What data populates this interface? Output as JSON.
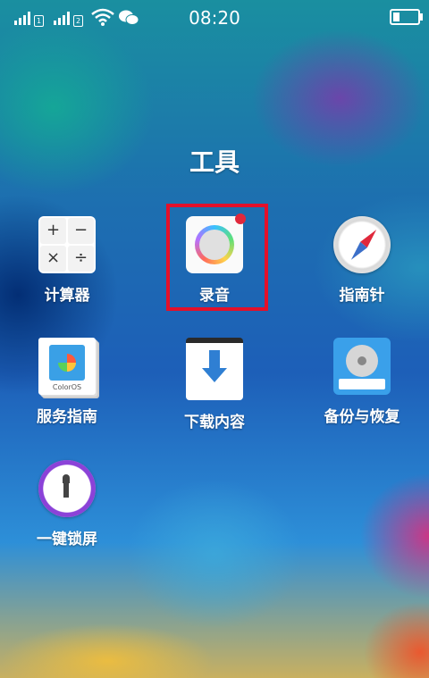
{
  "status_bar": {
    "sim1_label": "1",
    "sim2_label": "2",
    "time": "08:20",
    "icons": [
      "signal-icon",
      "signal-icon",
      "wifi-icon",
      "wechat-icon",
      "battery-icon"
    ],
    "battery_level": 0.25
  },
  "folder": {
    "title": "工具",
    "apps": [
      {
        "label": "计算器",
        "icon": "calculator-icon"
      },
      {
        "label": "录音",
        "icon": "recorder-icon",
        "highlighted": true
      },
      {
        "label": "指南针",
        "icon": "compass-icon"
      },
      {
        "label": "服务指南",
        "icon": "guide-icon",
        "icon_text": "ColorOS"
      },
      {
        "label": "下载内容",
        "icon": "download-icon"
      },
      {
        "label": "备份与恢复",
        "icon": "backup-icon"
      },
      {
        "label": "一键锁屏",
        "icon": "lock-icon"
      }
    ],
    "calculator_keys": [
      "+",
      "−",
      "×",
      "÷"
    ]
  },
  "colors": {
    "highlight": "#e3102a"
  }
}
